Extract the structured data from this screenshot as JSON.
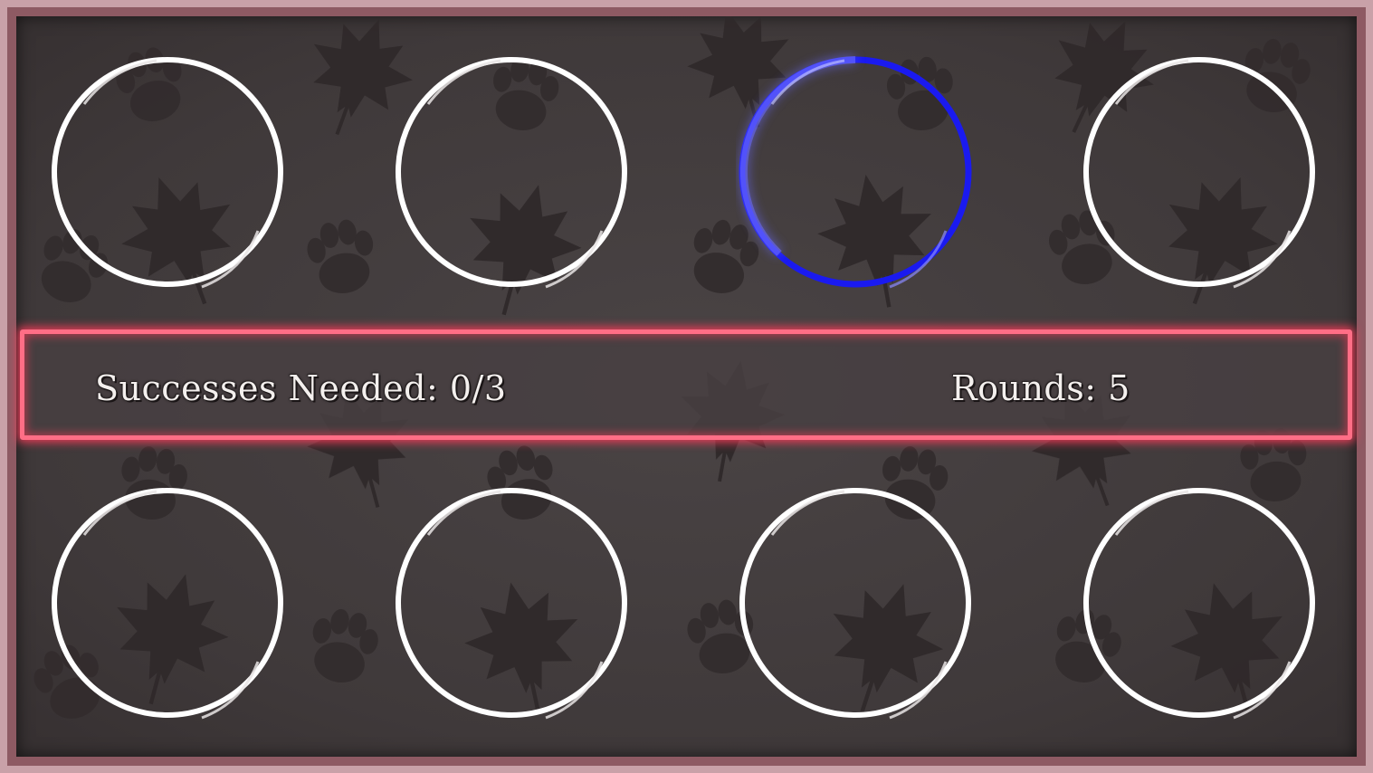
{
  "hud": {
    "successes_label": "Successes Needed: 0/3",
    "rounds_label": "Rounds: 5"
  },
  "colors": {
    "frame": "#c9a1a8",
    "banner_glow": "#ff6e86",
    "slot_ring": "#ffffff",
    "active_ring": "#1010e0"
  },
  "slots": [
    {
      "row": "top",
      "index": 1,
      "state": "idle"
    },
    {
      "row": "top",
      "index": 2,
      "state": "idle"
    },
    {
      "row": "top",
      "index": 3,
      "state": "active"
    },
    {
      "row": "top",
      "index": 4,
      "state": "idle"
    },
    {
      "row": "bottom",
      "index": 1,
      "state": "idle"
    },
    {
      "row": "bottom",
      "index": 2,
      "state": "idle"
    },
    {
      "row": "bottom",
      "index": 3,
      "state": "idle"
    },
    {
      "row": "bottom",
      "index": 4,
      "state": "idle"
    }
  ]
}
